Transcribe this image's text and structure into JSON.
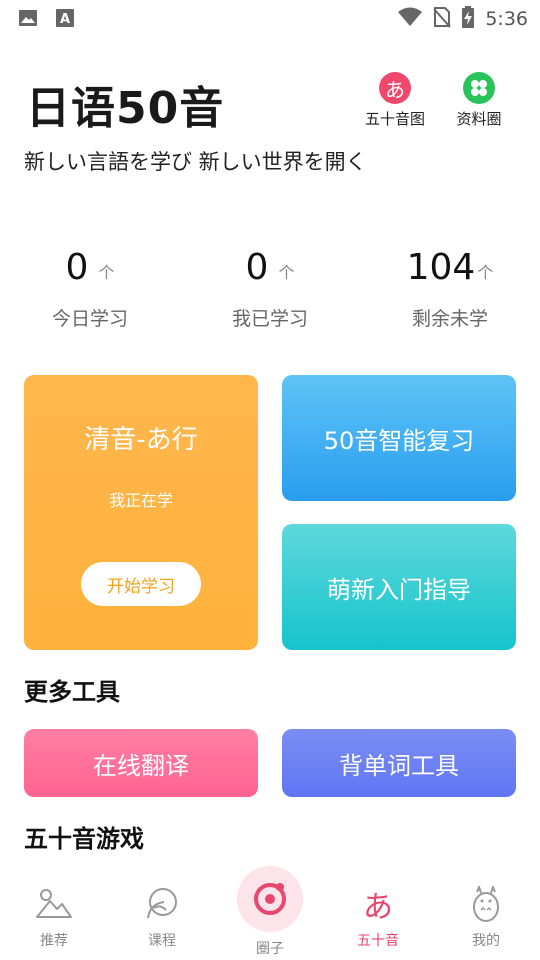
{
  "status_bar": {
    "time": "5:36",
    "left_icons": [
      "image-icon",
      "font-icon"
    ],
    "right_icons": [
      "wifi-icon",
      "no-sim-icon",
      "battery-charging-icon"
    ]
  },
  "header": {
    "title": "日语50音",
    "subtitle": "新しい言語を学び 新しい世界を開く",
    "actions": [
      {
        "label": "五十音图",
        "icon": "あ",
        "color": "#f0476d"
      },
      {
        "label": "资料圈",
        "icon": "clover-icon",
        "color": "#2bc45c"
      }
    ]
  },
  "stats": [
    {
      "value": "0",
      "unit": "个",
      "label": "今日学习"
    },
    {
      "value": "0",
      "unit": "个",
      "label": "我已学习"
    },
    {
      "value": "104",
      "unit": "个",
      "label": "剩余未学"
    }
  ],
  "cards": {
    "current": {
      "title": "清音-あ行",
      "status": "我正在学",
      "button": "开始学习"
    },
    "review": {
      "label": "50音智能复习"
    },
    "guide": {
      "label": "萌新入门指导"
    }
  },
  "tools": {
    "title": "更多工具",
    "translate": "在线翻译",
    "words": "背单词工具"
  },
  "games": {
    "title": "五十音游戏"
  },
  "nav": {
    "items": [
      {
        "label": "推荐",
        "icon": "mountain-icon"
      },
      {
        "label": "课程",
        "icon": "leaf-bubble-icon"
      },
      {
        "label": "圈子",
        "icon": "circle-dot-icon"
      },
      {
        "label": "五十音",
        "icon": "あ",
        "active": true
      },
      {
        "label": "我的",
        "icon": "totoro-icon"
      }
    ],
    "active_color": "#e8466c"
  }
}
